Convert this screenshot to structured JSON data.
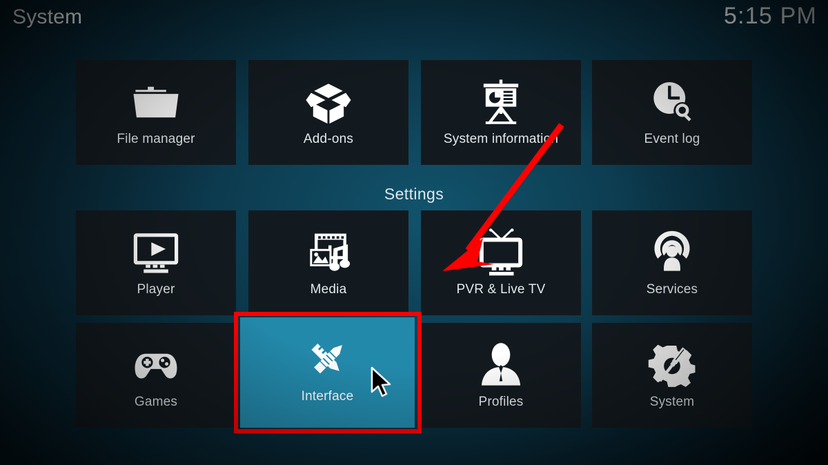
{
  "header": {
    "title": "System",
    "clock": "5:15 PM"
  },
  "section": {
    "label": "Settings"
  },
  "colors": {
    "tile_background": "#131a1f",
    "tile_selected": "#2389ab",
    "annotation_red": "#ff0000",
    "text": "#e3eaee",
    "page_background": "#0a2c3c"
  },
  "tiles": {
    "row1": [
      {
        "label": "File manager",
        "icon": "folder-icon",
        "selected": false
      },
      {
        "label": "Add-ons",
        "icon": "open-box-icon",
        "selected": false
      },
      {
        "label": "System information",
        "icon": "presentation-chart-icon",
        "selected": false
      },
      {
        "label": "Event log",
        "icon": "clock-search-icon",
        "selected": false
      }
    ],
    "row2": [
      {
        "label": "Player",
        "icon": "monitor-play-icon",
        "selected": false
      },
      {
        "label": "Media",
        "icon": "film-photo-music-icon",
        "selected": false
      },
      {
        "label": "PVR & Live TV",
        "icon": "television-antenna-icon",
        "selected": false
      },
      {
        "label": "Services",
        "icon": "broadcast-person-icon",
        "selected": false
      }
    ],
    "row3": [
      {
        "label": "Games",
        "icon": "gamepad-icon",
        "selected": false
      },
      {
        "label": "Interface",
        "icon": "pencil-ruler-icon",
        "selected": true
      },
      {
        "label": "Profiles",
        "icon": "person-bust-icon",
        "selected": false
      },
      {
        "label": "System",
        "icon": "gear-screwdriver-icon",
        "selected": false
      }
    ]
  },
  "annotations": {
    "highlight_target": "Interface",
    "arrow_target": "PVR & Live TV",
    "cursor_over": "Interface"
  }
}
